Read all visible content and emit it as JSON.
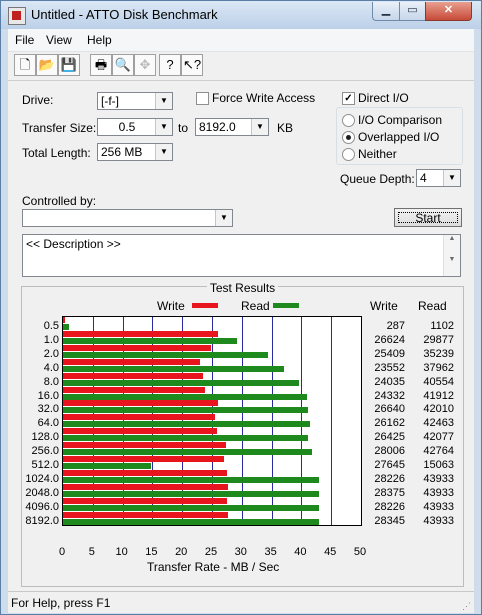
{
  "window": {
    "title": "Untitled - ATTO Disk Benchmark"
  },
  "menu": {
    "items": [
      "File",
      "View",
      "Help"
    ]
  },
  "toolbar": {
    "buttons": [
      "new-icon",
      "open-icon",
      "save-icon",
      "print-icon",
      "print-preview-icon",
      "move-icon",
      "help-icon",
      "context-help-icon"
    ]
  },
  "form": {
    "drive_label": "Drive:",
    "drive_value": "[-f-]",
    "force_write_label": "Force Write Access",
    "force_write_checked": false,
    "direct_io_label": "Direct I/O",
    "direct_io_checked": true,
    "transfer_size_label": "Transfer Size:",
    "transfer_from": "0.5",
    "to_label": "to",
    "transfer_to": "8192.0",
    "kb_label": "KB",
    "total_length_label": "Total Length:",
    "total_length": "256 MB",
    "io_options": [
      "I/O Comparison",
      "Overlapped I/O",
      "Neither"
    ],
    "io_selected": "Overlapped I/O",
    "queue_depth_label": "Queue Depth:",
    "queue_depth": "4",
    "controlled_by_label": "Controlled by:",
    "controlled_by_value": "",
    "start_label": "Start",
    "description": "<< Description >>"
  },
  "results": {
    "title": "Test Results",
    "legend_write": "Write",
    "legend_read": "Read",
    "col_write": "Write",
    "col_read": "Read",
    "xlabel": "Transfer Rate - MB / Sec",
    "colors": {
      "write": "#e8141e",
      "read": "#1e8a1e",
      "grid": "#2a2aa0"
    }
  },
  "chart_data": {
    "type": "bar",
    "orientation": "horizontal",
    "title": "Test Results",
    "xlabel": "Transfer Rate - MB / Sec",
    "xlim": [
      0,
      50
    ],
    "xticks": [
      0,
      5,
      10,
      15,
      20,
      25,
      30,
      35,
      40,
      45,
      50
    ],
    "categories": [
      "0.5",
      "1.0",
      "2.0",
      "4.0",
      "8.0",
      "16.0",
      "32.0",
      "64.0",
      "128.0",
      "256.0",
      "512.0",
      "1024.0",
      "2048.0",
      "4096.0",
      "8192.0"
    ],
    "series": [
      {
        "name": "Write",
        "values": [
          287,
          26624,
          25409,
          23552,
          24035,
          24332,
          26640,
          26162,
          26425,
          28006,
          27645,
          28226,
          28375,
          28226,
          28345
        ]
      },
      {
        "name": "Read",
        "values": [
          1102,
          29877,
          35239,
          37962,
          40554,
          41912,
          42010,
          42463,
          42077,
          42764,
          15063,
          43933,
          43933,
          43933,
          43933
        ]
      }
    ],
    "legend": "top",
    "grid": true
  },
  "status": {
    "text": "For Help, press F1"
  }
}
